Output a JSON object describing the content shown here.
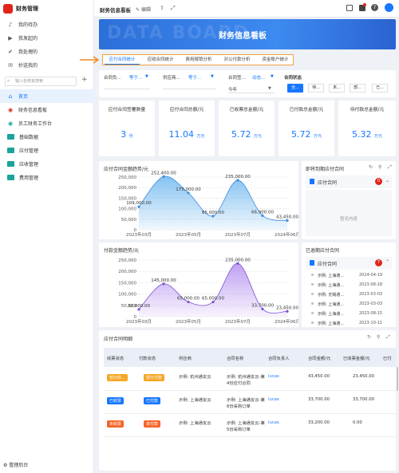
{
  "app": {
    "title": "财务管理"
  },
  "sidebar": {
    "top_items": [
      {
        "label": "我的待办",
        "icon": "bell-icon"
      },
      {
        "label": "我发起的",
        "icon": "send-icon"
      },
      {
        "label": "我处理的",
        "icon": "check-icon"
      },
      {
        "label": "抄送我的",
        "icon": "cc-icon"
      }
    ],
    "search_placeholder": "输入名称来搜索",
    "menu": [
      {
        "label": "首页",
        "icon": "home-icon"
      },
      {
        "label": "财务信息看板",
        "icon": "dashboard-icon"
      },
      {
        "label": "员工财务工作台",
        "icon": "workbench-icon"
      },
      {
        "label": "基础数据",
        "icon": "folder-icon"
      },
      {
        "label": "应付管理",
        "icon": "folder-icon"
      },
      {
        "label": "应收管理",
        "icon": "folder-icon"
      },
      {
        "label": "费用管理",
        "icon": "folder-icon"
      }
    ],
    "footer": "管理后台"
  },
  "topbar": {
    "title": "财务信息看板",
    "edit": "编辑"
  },
  "banner": {
    "title": "财务信息看板",
    "watermark": "DATA BOARD"
  },
  "tabs": [
    "应付合同统计",
    "应收合同统计",
    "费用报销分析",
    "对公付款分析",
    "资金账户统计"
  ],
  "filters": {
    "f1_label": "合同负...",
    "f1_value": "等于...",
    "f2_label": "供应商...",
    "f2_value": "等于...",
    "f3_label": "合同签...",
    "f3_value": "动态...",
    "f3_sub": "今年",
    "status_label": "合同状态",
    "status_options": [
      "全...",
      "待...",
      "未...",
      "部...",
      "已..."
    ]
  },
  "kpis": [
    {
      "title": "应付合同签署数量",
      "value": "3",
      "unit": "份"
    },
    {
      "title": "应付合同总额/元",
      "value": "11.04",
      "unit": "万元"
    },
    {
      "title": "已收票总金额/元",
      "value": "5.72",
      "unit": "万元"
    },
    {
      "title": "已付款总金额/元",
      "value": "5.72",
      "unit": "万元"
    },
    {
      "title": "待付款总金额/元",
      "value": "5.32",
      "unit": "万元"
    }
  ],
  "chart1": {
    "title": "应付合同金额趋势/元"
  },
  "chart2": {
    "title": "付款金额趋势/元"
  },
  "chart_data": [
    {
      "type": "area",
      "title": "应付合同金额趋势/元",
      "ylim": [
        0,
        250000
      ],
      "yticks": [
        "250,000",
        "200,000",
        "150,000",
        "100,000",
        "50,000",
        "0"
      ],
      "xticks": [
        "2023年03月",
        "2023年05月",
        "2023年07月",
        "2024年06月"
      ],
      "points": [
        {
          "x": "2023年03月",
          "y": 109000,
          "label": "109,000.00"
        },
        {
          "x": "2023年04月",
          "y": 252400,
          "label": "252,400.00"
        },
        {
          "x": "2023年05月",
          "y": 175000,
          "label": "175,000.00"
        },
        {
          "x": "2023年06月",
          "y": 65000,
          "label": "65,000.00"
        },
        {
          "x": "2023年07月",
          "y": 235000,
          "label": "235,000.00"
        },
        {
          "x": "2023年08月",
          "y": 66900,
          "label": "66,900.00"
        },
        {
          "x": "2024年06月",
          "y": 43450,
          "label": "43,450.00"
        }
      ]
    },
    {
      "type": "area",
      "title": "付款金额趋势/元",
      "ylim": [
        0,
        250000
      ],
      "yticks": [
        "250,000",
        "200,000",
        "150,000",
        "100,000",
        "50,000",
        "0"
      ],
      "xticks": [
        "2023年03月",
        "2023年05月",
        "2023年07月",
        "2024年06月"
      ],
      "points": [
        {
          "x": "2023年03月",
          "y": 32000,
          "label": "32,000.00"
        },
        {
          "x": "2023年04月",
          "y": 145000,
          "label": "145,000.00"
        },
        {
          "x": "2023年05月",
          "y": 65000,
          "label": "65,000.00"
        },
        {
          "x": "2023年06月",
          "y": 65000,
          "label": "65,000.00"
        },
        {
          "x": "2023年07月",
          "y": 235000,
          "label": "235,000.00"
        },
        {
          "x": "2023年08月",
          "y": 33700,
          "label": "33,700.00"
        },
        {
          "x": "2024年06月",
          "y": 23450,
          "label": "23,450.00"
        }
      ]
    }
  ],
  "panel1": {
    "title": "即将到期应付合同",
    "tab": "应付合同",
    "count": "0",
    "empty": "暂无内容"
  },
  "panel2": {
    "title": "已逾期应付合同",
    "tab": "应付合同",
    "count": "7",
    "rows": [
      {
        "name": "示例: 上海通...",
        "date": "2024-04-19"
      },
      {
        "name": "示例: 上海通...",
        "date": "2023-08-18"
      },
      {
        "name": "示例: 无锡通...",
        "date": "2023-03-03"
      },
      {
        "name": "示例: 上海通...",
        "date": "2023-03-03"
      },
      {
        "name": "示例: 上海通...",
        "date": "2023-08-15"
      },
      {
        "name": "示例: 上海通...",
        "date": "2023-10-11"
      }
    ]
  },
  "table": {
    "title": "应付合同明细",
    "headers": [
      "收票状态",
      "付款状态",
      "供应商",
      "合同名称",
      "合同负责人",
      "合同金额/元",
      "已收票金额/元",
      "已付"
    ],
    "rows": [
      {
        "r": "部分收...",
        "p": "部分付款",
        "s": "示例: 杭州通友云",
        "n": "示例: 杭州通友云-第4份应付合同",
        "o": "lucas",
        "a": "43,450.00",
        "b": "23,450.00",
        "rc": "#f5a623",
        "pc": "#f5a623"
      },
      {
        "r": "已收票",
        "p": "已付款",
        "s": "示例: 上海通友云",
        "n": "示例: 上海通友云-第6份采购订单",
        "o": "lucas",
        "a": "33,700.00",
        "b": "33,700.00",
        "rc": "#1677ff",
        "pc": "#1677ff"
      },
      {
        "r": "未收票",
        "p": "未付款",
        "s": "示例: 上海通友云",
        "n": "示例: 上海通友云-第5份采购订单",
        "o": "lucas",
        "a": "33,200.00",
        "b": "0.00",
        "rc": "#f5642a",
        "pc": "#f5642a"
      }
    ]
  }
}
